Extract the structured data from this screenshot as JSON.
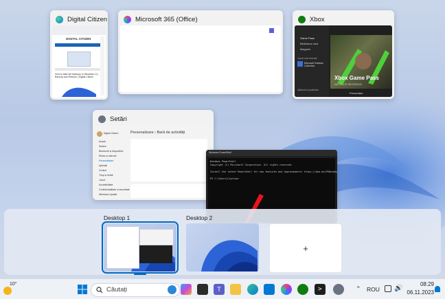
{
  "windows": [
    {
      "title": "Digital Citizen - L..."
    },
    {
      "title": "Microsoft 365 (Office)"
    },
    {
      "title": "Xbox"
    },
    {
      "title": "Setări"
    },
    {
      "title": "Windows PowerShell"
    }
  ],
  "edge_thumb": {
    "header": "DIGITAL CITIZEN",
    "article": "How to take full backups in Windows 11 | Backup and Restore | Digital Citizen"
  },
  "xbox_thumb": {
    "hero_title": "Xbox Game Pass",
    "hero_sub": "MAI MULTE INFORMAȚII",
    "nav": [
      "Game Pass",
      "Biblioteca mea",
      "Magazin"
    ],
    "recent_heading": "Jocuri mai recente",
    "recent_item": "Microsoft Solitaire Collection",
    "promo": "Alătură-te jucătorilor",
    "footer": "Prezentare"
  },
  "settings_thumb": {
    "user": "Digital Citizen",
    "breadcrumb": "Personalizare › Bară de activități",
    "nav": [
      "Acasă",
      "Sistem",
      "Bluetooth și dispozitive",
      "Rețea și internet",
      "Personalizare",
      "Aplicații",
      "Conturi",
      "Timp și limbă",
      "Jocuri",
      "Accesibilitate",
      "Confidențialitate și securitate",
      "Windows Update"
    ]
  },
  "terminal": {
    "lines": [
      "Windows PowerShell",
      "Copyright (C) Microsoft Corporation. All rights reserved.",
      "",
      "Install the latest PowerShell for new features and improvements! https://aka.ms/PSWindows",
      "",
      "PS C:\\Users\\Ciprian>"
    ]
  },
  "desktops": [
    {
      "label": "Desktop 1"
    },
    {
      "label": "Desktop 2"
    }
  ],
  "new_desktop_symbol": "+",
  "taskbar": {
    "weather_temp": "10°",
    "search_placeholder": "Căutați",
    "language": "ROU",
    "time": "08:29",
    "date": "06.11.2023"
  },
  "colors": {
    "accent": "#0067c0",
    "arrow": "#e8141c",
    "terminal_bg": "#0c0c0c"
  }
}
